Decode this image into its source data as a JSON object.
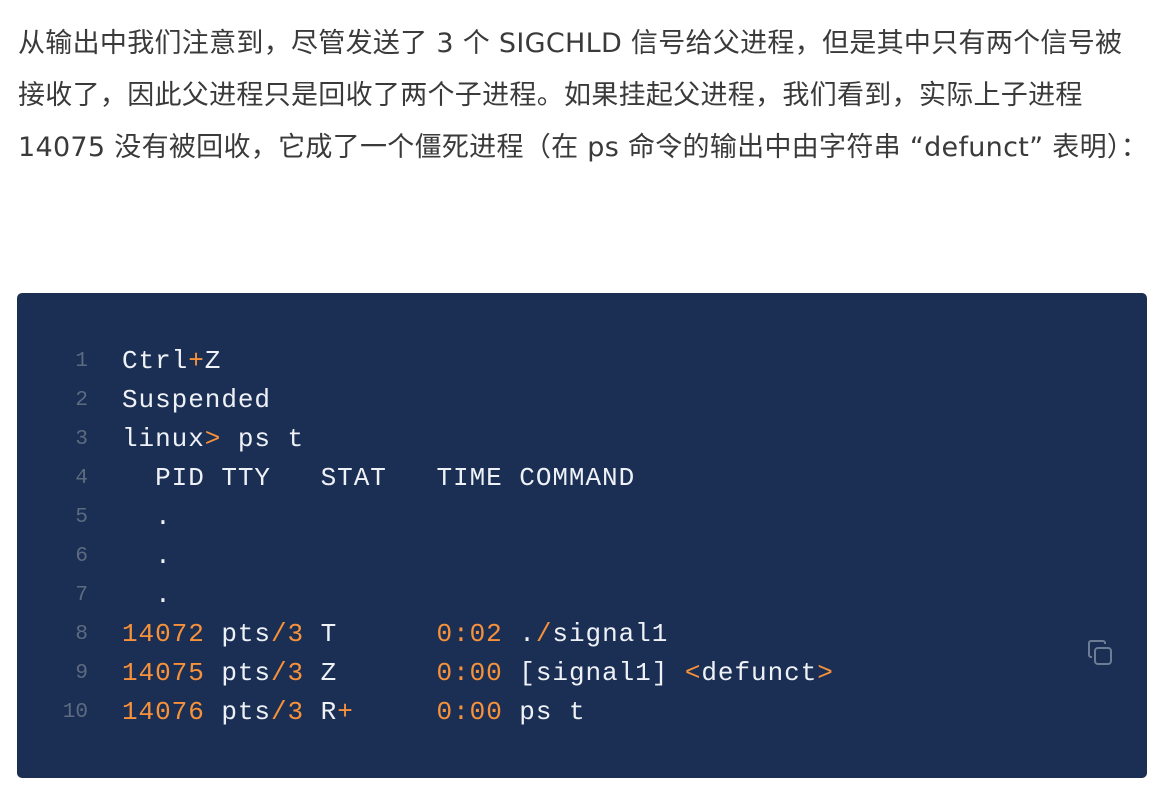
{
  "paragraph": "从输出中我们注意到，尽管发送了 3 个 SIGCHLD 信号给父进程，但是其中只有两个信号被接收了，因此父进程只是回收了两个子进程。如果挂起父进程，我们看到，实际上子进程 14075 没有被回收，它成了一个僵死进程（在 ps 命令的输出中由字符串 “defunct” 表明）：",
  "code": {
    "copy_icon": "copy-icon",
    "colors": {
      "background": "#1b2f55",
      "text": "#eef1f6",
      "accent": "#f7923a",
      "line_number": "#5d6b80"
    },
    "lines": [
      {
        "num": "1",
        "tokens": [
          {
            "t": "Ctrl"
          },
          {
            "t": "+",
            "o": true
          },
          {
            "t": "Z"
          }
        ]
      },
      {
        "num": "2",
        "tokens": [
          {
            "t": "Suspended"
          }
        ]
      },
      {
        "num": "3",
        "tokens": [
          {
            "t": "linux"
          },
          {
            "t": ">",
            "o": true
          },
          {
            "t": " ps t"
          }
        ]
      },
      {
        "num": "4",
        "tokens": [
          {
            "t": "  PID TTY   STAT   TIME COMMAND"
          }
        ]
      },
      {
        "num": "5",
        "tokens": [
          {
            "t": "  ."
          }
        ]
      },
      {
        "num": "6",
        "tokens": [
          {
            "t": "  ."
          }
        ]
      },
      {
        "num": "7",
        "tokens": [
          {
            "t": "  ."
          }
        ]
      },
      {
        "num": "8",
        "tokens": [
          {
            "t": "14072",
            "o": true
          },
          {
            "t": " pts"
          },
          {
            "t": "/3",
            "o": true
          },
          {
            "t": " T      "
          },
          {
            "t": "0:02",
            "o": true
          },
          {
            "t": " ."
          },
          {
            "t": "/",
            "o": true
          },
          {
            "t": "signal1"
          }
        ]
      },
      {
        "num": "9",
        "tokens": [
          {
            "t": "14075",
            "o": true
          },
          {
            "t": " pts"
          },
          {
            "t": "/3",
            "o": true
          },
          {
            "t": " Z      "
          },
          {
            "t": "0:00",
            "o": true
          },
          {
            "t": " [signal1] "
          },
          {
            "t": "<",
            "o": true
          },
          {
            "t": "defunct"
          },
          {
            "t": ">",
            "o": true
          }
        ]
      },
      {
        "num": "10",
        "tokens": [
          {
            "t": "14076",
            "o": true
          },
          {
            "t": " pts"
          },
          {
            "t": "/3",
            "o": true
          },
          {
            "t": " R"
          },
          {
            "t": "+",
            "o": true
          },
          {
            "t": "     "
          },
          {
            "t": "0:00",
            "o": true
          },
          {
            "t": " ps t"
          }
        ]
      }
    ]
  }
}
